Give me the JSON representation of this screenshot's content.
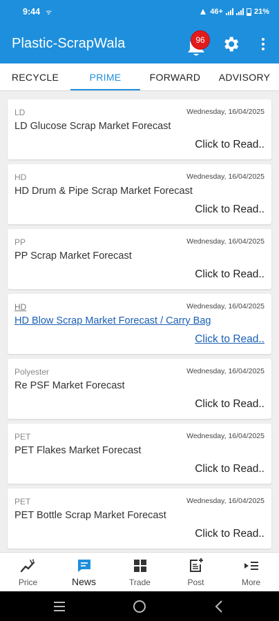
{
  "status_bar": {
    "time": "9:44",
    "network": "46+",
    "battery": "21%"
  },
  "app_bar": {
    "title": "Plastic-ScrapWala",
    "notification_count": "96"
  },
  "tabs": [
    {
      "label": "RECYCLE",
      "active": false
    },
    {
      "label": "PRIME",
      "active": true
    },
    {
      "label": "FORWARD",
      "active": false
    },
    {
      "label": "ADVISORY",
      "active": false
    }
  ],
  "cards": [
    {
      "category": "LD",
      "date": "Wednesday, 16/04/2025",
      "title": "LD Glucose Scrap Market Forecast",
      "cta": "Click to Read.."
    },
    {
      "category": "HD",
      "date": "Wednesday, 16/04/2025",
      "title": "HD Drum & Pipe Scrap Market Forecast",
      "cta": "Click to Read.."
    },
    {
      "category": "PP",
      "date": "Wednesday, 16/04/2025",
      "title": "PP Scrap Market Forecast",
      "cta": "Click to Read.."
    },
    {
      "category": "HD",
      "date": "Wednesday, 16/04/2025",
      "title": "HD Blow Scrap Market Forecast / Carry Bag",
      "cta": "Click to Read.."
    },
    {
      "category": "Polyester",
      "date": "Wednesday, 16/04/2025",
      "title": "Re PSF Market Forecast",
      "cta": "Click to Read.."
    },
    {
      "category": "PET",
      "date": "Wednesday, 16/04/2025",
      "title": "PET Flakes Market Forecast",
      "cta": "Click to Read.."
    },
    {
      "category": "PET",
      "date": "Wednesday, 16/04/2025",
      "title": "PET Bottle Scrap Market Forecast",
      "cta": "Click to Read.."
    }
  ],
  "bottom_nav": [
    {
      "label": "Price",
      "icon": "trend-icon",
      "active": false
    },
    {
      "label": "News",
      "icon": "chat-icon",
      "active": true
    },
    {
      "label": "Trade",
      "icon": "grid-icon",
      "active": false
    },
    {
      "label": "Post",
      "icon": "post-add-icon",
      "active": false
    },
    {
      "label": "More",
      "icon": "more-list-icon",
      "active": false
    }
  ],
  "colors": {
    "primary": "#1e8fdc",
    "badge": "#e21b1b",
    "link": "#1a5fb4"
  }
}
